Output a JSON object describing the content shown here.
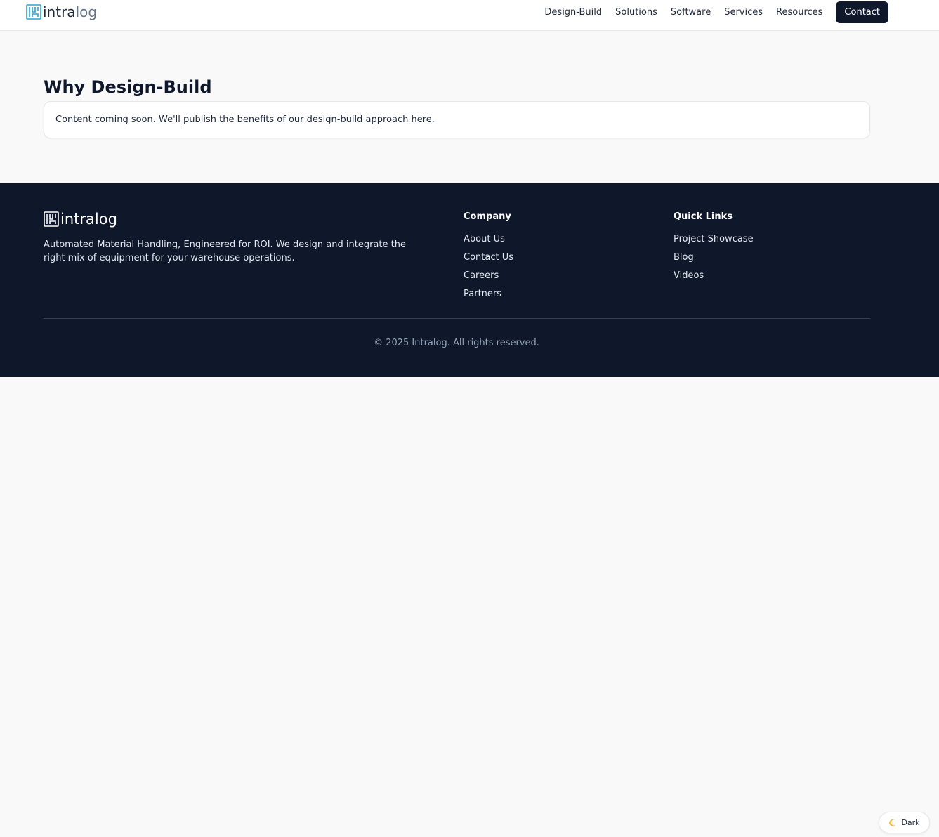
{
  "header": {
    "logo": {
      "part1": "intra",
      "part2": "log"
    },
    "nav": [
      "Design-Build",
      "Solutions",
      "Software",
      "Services",
      "Resources"
    ],
    "contact_label": "Contact"
  },
  "main": {
    "title": "Why Design-Build",
    "card_text": "Content coming soon. We'll publish the benefits of our design-build approach here."
  },
  "footer": {
    "logo": {
      "part1": "intra",
      "part2": "log"
    },
    "description": "Automated Material Handling, Engineered for ROI. We design and integrate the right mix of equipment for your warehouse operations.",
    "company": {
      "heading": "Company",
      "links": [
        "About Us",
        "Contact Us",
        "Careers",
        "Partners"
      ]
    },
    "quick_links": {
      "heading": "Quick Links",
      "links": [
        "Project Showcase",
        "Blog",
        "Videos"
      ]
    },
    "copyright": "© 2025 Intralog. All rights reserved."
  },
  "theme_toggle": {
    "label": "Dark",
    "icon": "moon-icon"
  },
  "colors": {
    "brand_blue": "#29a3d9",
    "dark_navy": "#0f172a",
    "page_bg": "#f9f9f9"
  }
}
